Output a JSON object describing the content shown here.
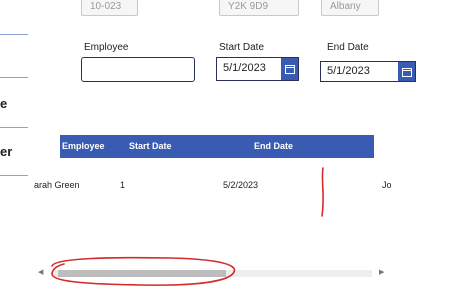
{
  "top_fields": [
    "10-023",
    "Y2K 9D9",
    "Albany"
  ],
  "nav": {
    "item_a": "e",
    "item_b": "er"
  },
  "form": {
    "employee_label": "Employee",
    "employee_value": "",
    "start_label": "Start Date",
    "start_value": "5/1/2023",
    "end_label": "End Date",
    "end_value": "5/1/2023"
  },
  "grid": {
    "columns": [
      "Employee",
      "Start Date",
      "End Date"
    ],
    "row": {
      "employee": "arah Green",
      "number": "1",
      "end_date": "5/2/2023",
      "trailing": "Jo"
    }
  },
  "colors": {
    "accent": "#3a5bb2",
    "annotation": "#d42b2b"
  },
  "icons": {
    "calendar": "calendar-icon"
  }
}
